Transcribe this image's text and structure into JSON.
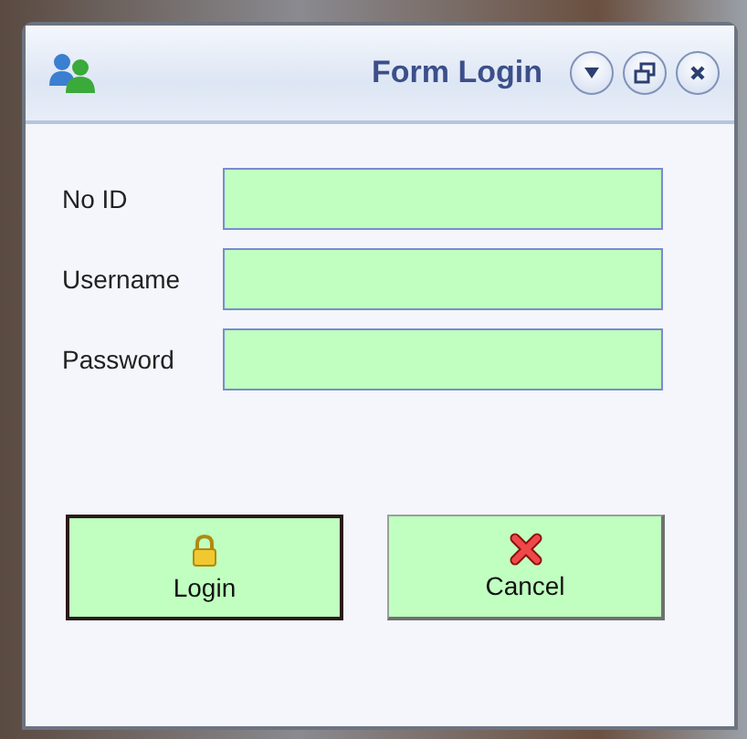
{
  "window": {
    "title": "Form Login"
  },
  "fields": [
    {
      "label": "No ID"
    },
    {
      "label": "Username"
    },
    {
      "label": "Password"
    }
  ],
  "buttons": [
    {
      "label": "Login",
      "kind": "lock",
      "default": true
    },
    {
      "label": "Cancel",
      "kind": "cross",
      "default": false
    }
  ]
}
